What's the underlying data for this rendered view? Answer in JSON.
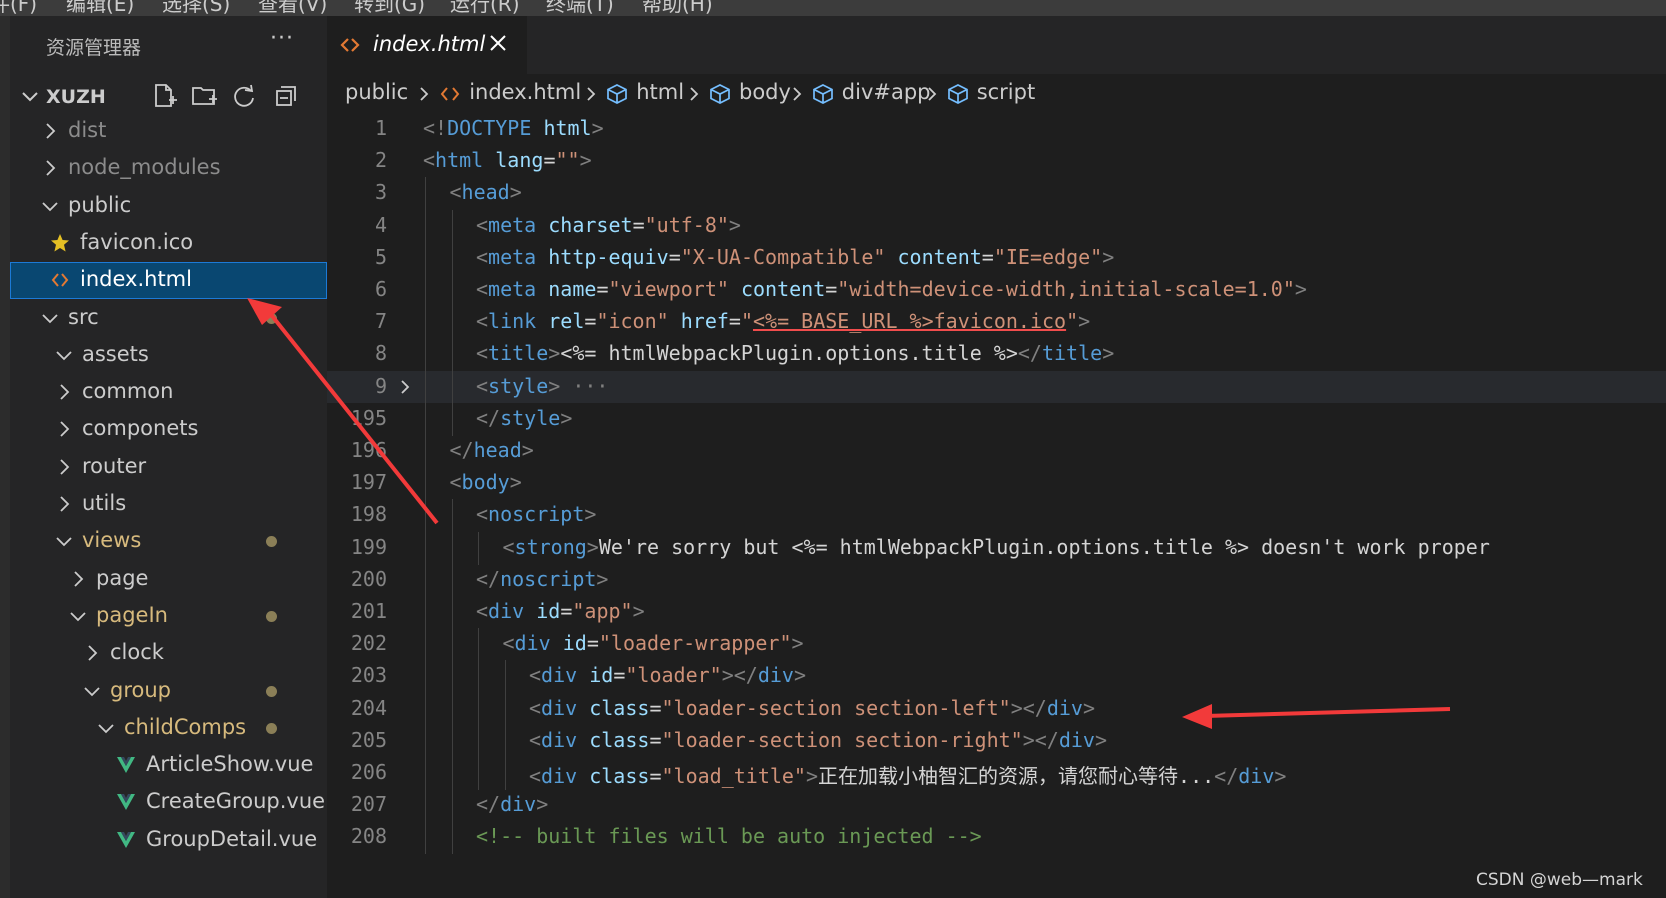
{
  "menubar": {
    "items": [
      "文件(F)",
      "编辑(E)",
      "选择(S)",
      "查看(V)",
      "转到(G)",
      "运行(R)",
      "终端(T)",
      "帮助(H)"
    ]
  },
  "sidebar": {
    "title": "资源管理器",
    "more": "···",
    "project": "XUZH",
    "tree": [
      {
        "label": "dist",
        "kind": "folder",
        "open": false,
        "depth": 0,
        "dim": true
      },
      {
        "label": "node_modules",
        "kind": "folder",
        "open": false,
        "depth": 0,
        "dim": true
      },
      {
        "label": "public",
        "kind": "folder",
        "open": true,
        "depth": 0
      },
      {
        "label": "favicon.ico",
        "kind": "star",
        "depth": 1
      },
      {
        "label": "index.html",
        "kind": "html",
        "depth": 1,
        "selected": true
      },
      {
        "label": "src",
        "kind": "folder",
        "open": true,
        "depth": 0,
        "dot": true
      },
      {
        "label": "assets",
        "kind": "folder",
        "open": true,
        "depth": 1
      },
      {
        "label": "common",
        "kind": "folder",
        "open": false,
        "depth": 1
      },
      {
        "label": "componets",
        "kind": "folder",
        "open": false,
        "depth": 1
      },
      {
        "label": "router",
        "kind": "folder",
        "open": false,
        "depth": 1
      },
      {
        "label": "utils",
        "kind": "folder",
        "open": false,
        "depth": 1
      },
      {
        "label": "views",
        "kind": "folder",
        "open": true,
        "depth": 1,
        "mod": true,
        "dot": true
      },
      {
        "label": "page",
        "kind": "folder",
        "open": false,
        "depth": 2
      },
      {
        "label": "pageIn",
        "kind": "folder",
        "open": true,
        "depth": 2,
        "mod": true,
        "dot": true
      },
      {
        "label": "clock",
        "kind": "folder",
        "open": false,
        "depth": 3
      },
      {
        "label": "group",
        "kind": "folder",
        "open": true,
        "depth": 3,
        "mod": true,
        "dot": true
      },
      {
        "label": "childComps",
        "kind": "folder",
        "open": true,
        "depth": 4,
        "mod": true,
        "dot": true
      },
      {
        "label": "ArticleShow.vue",
        "kind": "vue",
        "depth": 5
      },
      {
        "label": "CreateGroup.vue",
        "kind": "vue",
        "depth": 5
      },
      {
        "label": "GroupDetail.vue",
        "kind": "vue",
        "depth": 5
      }
    ]
  },
  "tab": {
    "label": "index.html"
  },
  "breadcrumb": [
    "public",
    "index.html",
    "html",
    "body",
    "div#app",
    "script"
  ],
  "code": [
    {
      "n": "1",
      "i": 0,
      "seg": [
        [
          "p",
          "<!"
        ],
        [
          "d",
          "DOCTYPE"
        ],
        [
          "w",
          " "
        ],
        [
          "a",
          "html"
        ],
        [
          "p",
          ">"
        ]
      ]
    },
    {
      "n": "2",
      "i": 0,
      "seg": [
        [
          "p",
          "<"
        ],
        [
          "t",
          "html"
        ],
        [
          "w",
          " "
        ],
        [
          "a",
          "lang"
        ],
        [
          "w",
          "="
        ],
        [
          "s",
          "\"\""
        ],
        [
          "p",
          ">"
        ]
      ]
    },
    {
      "n": "3",
      "i": 1,
      "seg": [
        [
          "p",
          "<"
        ],
        [
          "t",
          "head"
        ],
        [
          "p",
          ">"
        ]
      ]
    },
    {
      "n": "4",
      "i": 2,
      "seg": [
        [
          "p",
          "<"
        ],
        [
          "t",
          "meta"
        ],
        [
          "w",
          " "
        ],
        [
          "a",
          "charset"
        ],
        [
          "w",
          "="
        ],
        [
          "s",
          "\"utf-8\""
        ],
        [
          "p",
          ">"
        ]
      ]
    },
    {
      "n": "5",
      "i": 2,
      "seg": [
        [
          "p",
          "<"
        ],
        [
          "t",
          "meta"
        ],
        [
          "w",
          " "
        ],
        [
          "a",
          "http-equiv"
        ],
        [
          "w",
          "="
        ],
        [
          "s",
          "\"X-UA-Compatible\""
        ],
        [
          "w",
          " "
        ],
        [
          "a",
          "content"
        ],
        [
          "w",
          "="
        ],
        [
          "s",
          "\"IE=edge\""
        ],
        [
          "p",
          ">"
        ]
      ]
    },
    {
      "n": "6",
      "i": 2,
      "seg": [
        [
          "p",
          "<"
        ],
        [
          "t",
          "meta"
        ],
        [
          "w",
          " "
        ],
        [
          "a",
          "name"
        ],
        [
          "w",
          "="
        ],
        [
          "s",
          "\"viewport\""
        ],
        [
          "w",
          " "
        ],
        [
          "a",
          "content"
        ],
        [
          "w",
          "="
        ],
        [
          "s",
          "\"width=device-width,initial-scale=1.0\""
        ],
        [
          "p",
          ">"
        ]
      ]
    },
    {
      "n": "7",
      "i": 2,
      "seg": [
        [
          "p",
          "<"
        ],
        [
          "t",
          "link"
        ],
        [
          "w",
          " "
        ],
        [
          "a",
          "rel"
        ],
        [
          "w",
          "="
        ],
        [
          "s",
          "\"icon\""
        ],
        [
          "w",
          " "
        ],
        [
          "a",
          "href"
        ],
        [
          "w",
          "="
        ],
        [
          "s",
          "\""
        ],
        [
          "sq",
          "<%= BASE_URL %>favicon.ico"
        ],
        [
          "s",
          "\""
        ],
        [
          "p",
          ">"
        ]
      ]
    },
    {
      "n": "8",
      "i": 2,
      "seg": [
        [
          "p",
          "<"
        ],
        [
          "t",
          "title"
        ],
        [
          "p",
          ">"
        ],
        [
          "w",
          "<%= htmlWebpackPlugin.options.title %>"
        ],
        [
          "p",
          "</"
        ],
        [
          "t",
          "title"
        ],
        [
          "p",
          ">"
        ]
      ]
    },
    {
      "n": "9",
      "i": 2,
      "cur": true,
      "fold": true,
      "seg": [
        [
          "p",
          "<"
        ],
        [
          "t",
          "style"
        ],
        [
          "p",
          ">"
        ],
        [
          "p",
          " ···"
        ]
      ]
    },
    {
      "n": "195",
      "i": 2,
      "seg": [
        [
          "p",
          "</"
        ],
        [
          "t",
          "style"
        ],
        [
          "p",
          ">"
        ]
      ]
    },
    {
      "n": "196",
      "i": 1,
      "seg": [
        [
          "p",
          "</"
        ],
        [
          "t",
          "head"
        ],
        [
          "p",
          ">"
        ]
      ]
    },
    {
      "n": "197",
      "i": 1,
      "seg": [
        [
          "p",
          "<"
        ],
        [
          "t",
          "body"
        ],
        [
          "p",
          ">"
        ]
      ]
    },
    {
      "n": "198",
      "i": 2,
      "seg": [
        [
          "p",
          "<"
        ],
        [
          "t",
          "noscript"
        ],
        [
          "p",
          ">"
        ]
      ]
    },
    {
      "n": "199",
      "i": 3,
      "seg": [
        [
          "p",
          "<"
        ],
        [
          "t",
          "strong"
        ],
        [
          "p",
          ">"
        ],
        [
          "w",
          "We're sorry but <%= htmlWebpackPlugin.options.title %> doesn't work proper"
        ]
      ]
    },
    {
      "n": "200",
      "i": 2,
      "seg": [
        [
          "p",
          "</"
        ],
        [
          "t",
          "noscript"
        ],
        [
          "p",
          ">"
        ]
      ]
    },
    {
      "n": "201",
      "i": 2,
      "seg": [
        [
          "p",
          "<"
        ],
        [
          "t",
          "div"
        ],
        [
          "w",
          " "
        ],
        [
          "a",
          "id"
        ],
        [
          "w",
          "="
        ],
        [
          "s",
          "\"app\""
        ],
        [
          "p",
          ">"
        ]
      ]
    },
    {
      "n": "202",
      "i": 3,
      "seg": [
        [
          "p",
          "<"
        ],
        [
          "t",
          "div"
        ],
        [
          "w",
          " "
        ],
        [
          "a",
          "id"
        ],
        [
          "w",
          "="
        ],
        [
          "s",
          "\"loader-wrapper\""
        ],
        [
          "p",
          ">"
        ]
      ]
    },
    {
      "n": "203",
      "i": 4,
      "seg": [
        [
          "p",
          "<"
        ],
        [
          "t",
          "div"
        ],
        [
          "w",
          " "
        ],
        [
          "a",
          "id"
        ],
        [
          "w",
          "="
        ],
        [
          "s",
          "\"loader\""
        ],
        [
          "p",
          "></"
        ],
        [
          "t",
          "div"
        ],
        [
          "p",
          ">"
        ]
      ]
    },
    {
      "n": "204",
      "i": 4,
      "seg": [
        [
          "p",
          "<"
        ],
        [
          "t",
          "div"
        ],
        [
          "w",
          " "
        ],
        [
          "a",
          "class"
        ],
        [
          "w",
          "="
        ],
        [
          "s",
          "\"loader-section section-left\""
        ],
        [
          "p",
          "></"
        ],
        [
          "t",
          "div"
        ],
        [
          "p",
          ">"
        ]
      ]
    },
    {
      "n": "205",
      "i": 4,
      "seg": [
        [
          "p",
          "<"
        ],
        [
          "t",
          "div"
        ],
        [
          "w",
          " "
        ],
        [
          "a",
          "class"
        ],
        [
          "w",
          "="
        ],
        [
          "s",
          "\"loader-section section-right\""
        ],
        [
          "p",
          "></"
        ],
        [
          "t",
          "div"
        ],
        [
          "p",
          ">"
        ]
      ]
    },
    {
      "n": "206",
      "i": 4,
      "seg": [
        [
          "p",
          "<"
        ],
        [
          "t",
          "div"
        ],
        [
          "w",
          " "
        ],
        [
          "a",
          "class"
        ],
        [
          "w",
          "="
        ],
        [
          "s",
          "\"load_title\""
        ],
        [
          "p",
          ">"
        ],
        [
          "w",
          "正在加载小柚智汇的资源，请您耐心等待..."
        ],
        [
          "p",
          "</"
        ],
        [
          "t",
          "div"
        ],
        [
          "p",
          ">"
        ]
      ]
    },
    {
      "n": "207",
      "i": 2,
      "seg": [
        [
          "p",
          "</"
        ],
        [
          "t",
          "div"
        ],
        [
          "p",
          ">"
        ]
      ]
    },
    {
      "n": "208",
      "i": 2,
      "seg": [
        [
          "c",
          "<!-- built files will be auto injected -->"
        ]
      ]
    }
  ],
  "watermark": "CSDN @web—mark",
  "colors": {
    "annotation_arrow": "#f23a3a",
    "selection": "#094771",
    "tag": "#569cd6",
    "string": "#ce9178",
    "attribute": "#9cdcfe"
  }
}
